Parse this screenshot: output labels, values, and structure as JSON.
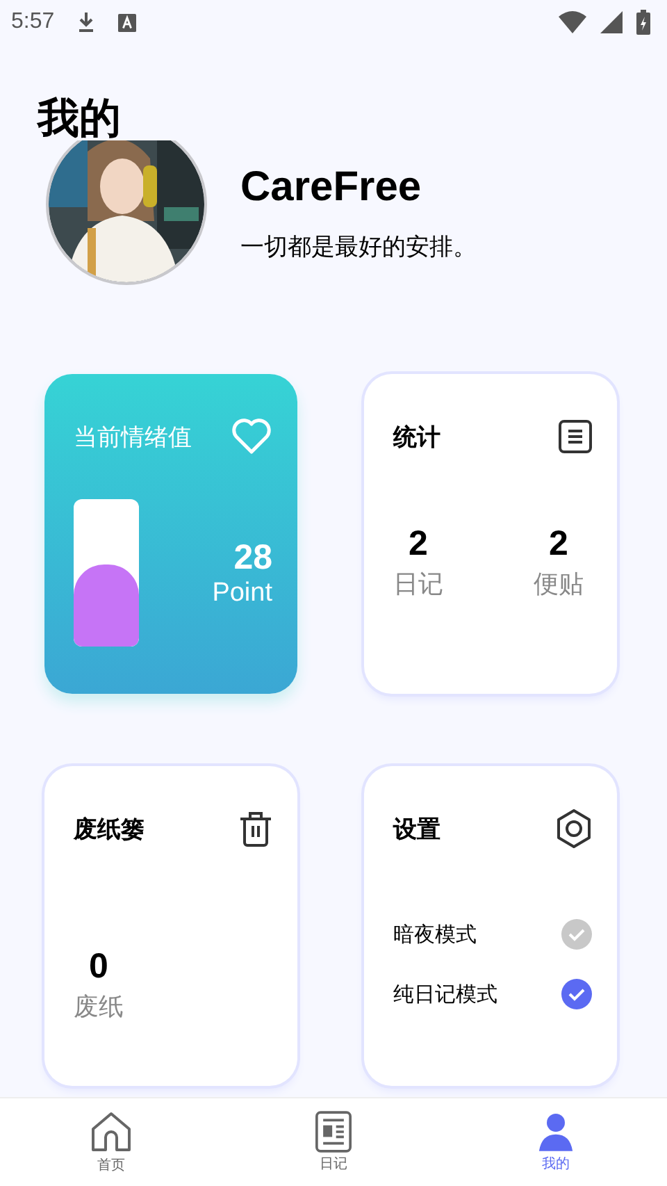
{
  "status_bar": {
    "time": "5:57"
  },
  "page_title": "我的",
  "profile": {
    "name": "CareFree",
    "motto": "一切都是最好的安排。"
  },
  "mood_card": {
    "title": "当前情绪值",
    "level": 0.56,
    "value": "28",
    "unit": "Point"
  },
  "stats_card": {
    "title": "统计",
    "items": [
      {
        "value": "2",
        "label": "日记"
      },
      {
        "value": "2",
        "label": "便贴"
      }
    ]
  },
  "trash_card": {
    "title": "废纸篓",
    "value": "0",
    "label": "废纸"
  },
  "settings_card": {
    "title": "设置",
    "options": [
      {
        "label": "暗夜模式",
        "checked": false
      },
      {
        "label": "纯日记模式",
        "checked": true
      }
    ]
  },
  "bottom_nav": [
    {
      "label": "首页",
      "kind": "home",
      "selected": false
    },
    {
      "label": "日记",
      "kind": "diary",
      "selected": false
    },
    {
      "label": "我的",
      "kind": "profile",
      "selected": true
    }
  ]
}
